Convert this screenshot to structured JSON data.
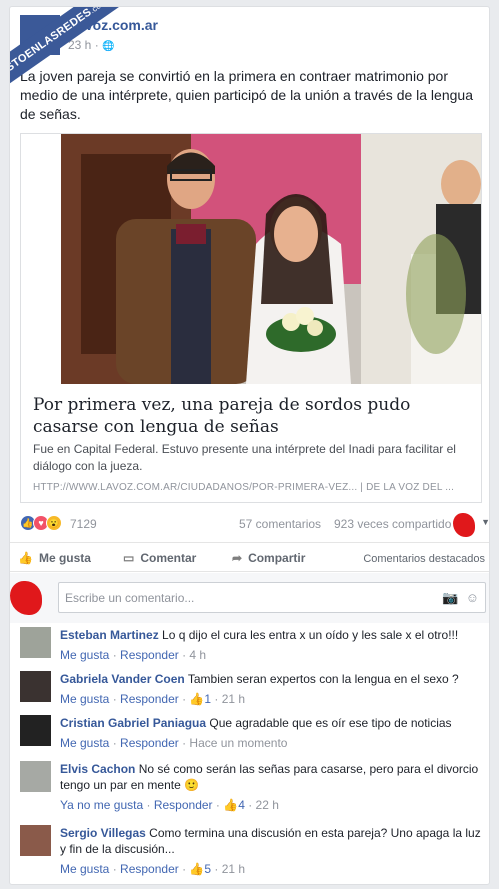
{
  "watermark": {
    "main": "VISTOENLASREDES",
    "sub": ".com"
  },
  "post": {
    "page_name": "LaVoz.com.ar",
    "time": "23 h",
    "privacy_icon": "globe-icon",
    "text": "La joven pareja se convirtió en la primera en contraer matrimonio por medio de una intérprete, quien participó de la unión a través de la lengua de señas."
  },
  "link": {
    "title": "Por primera vez, una pareja de sordos pudo casarse con lengua de señas",
    "description": "Fue en Capital Federal. Estuvo presente una intérprete del Inadi para facilitar el diálogo con la jueza.",
    "url": "HTTP://WWW.LAVOZ.COM.AR/CIUDADANOS/POR-PRIMERA-VEZ...  |  DE LA VOZ DEL ..."
  },
  "stats": {
    "reaction_icons": [
      "like-icon",
      "love-icon",
      "wow-icon"
    ],
    "reactions": "7129",
    "comments": "57 comentarios",
    "shares": "923 veces compartido"
  },
  "actions": {
    "like": "Me gusta",
    "comment": "Comentar",
    "share": "Compartir",
    "featured": "Comentarios destacados"
  },
  "composer": {
    "placeholder": "Escribe un comentario..."
  },
  "comments": [
    {
      "name": "Esteban Martinez",
      "text": "Lo q dijo el cura les entra x un oído y les sale x el otro!!!",
      "like": "Me gusta",
      "reply": "Responder",
      "likes": "",
      "time": "4 h"
    },
    {
      "name": "Gabriela Vander Coen",
      "text": "Tambien seran expertos con la lengua en el sexo ?",
      "like": "Me gusta",
      "reply": "Responder",
      "likes": "1",
      "time": "21 h"
    },
    {
      "name": "Cristian Gabriel Paniagua",
      "text": "Que agradable que es oír ese tipo de noticias",
      "like": "Me gusta",
      "reply": "Responder",
      "likes": "",
      "time": "Hace un momento"
    },
    {
      "name": "Elvis Cachon",
      "text": "No sé como serán las señas para casarse, pero para el divorcio tengo un par en mente 🙂",
      "like": "Ya no me gusta",
      "reply": "Responder",
      "likes": "4",
      "time": "22 h"
    },
    {
      "name": "Sergio Villegas",
      "text": "Como termina una discusión en esta pareja? Uno apaga la luz y fin de la discusión...",
      "like": "Me gusta",
      "reply": "Responder",
      "likes": "5",
      "time": "21 h"
    }
  ]
}
